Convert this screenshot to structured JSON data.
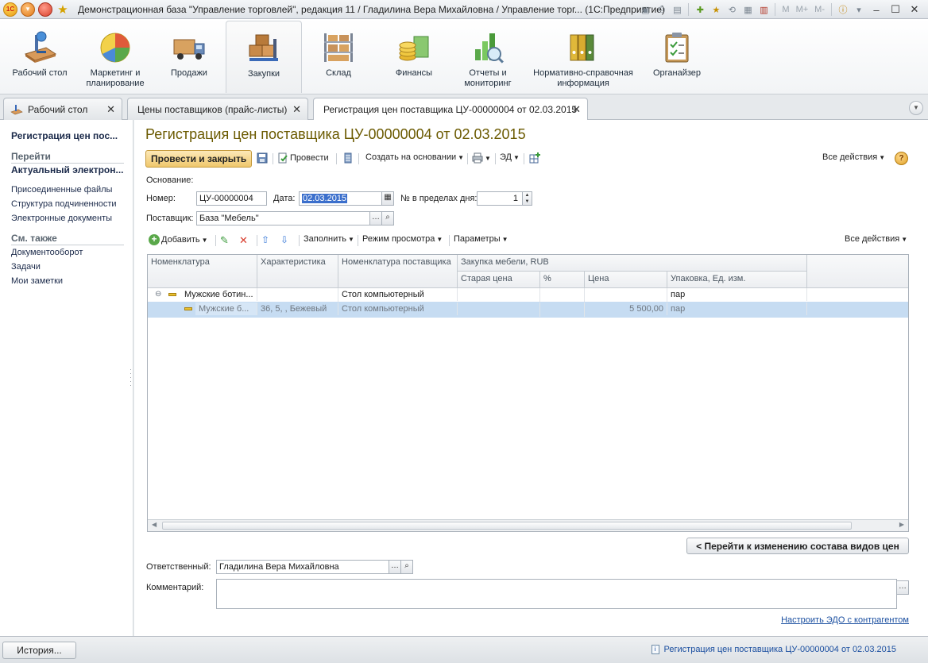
{
  "titlebar": {
    "title": "Демонстрационная база \"Управление торговлей\", редакция 11 / Гладилина Вера Михайловна / Управление торг...  (1С:Предприятие)",
    "mem_labels": [
      "M",
      "M+",
      "M-"
    ]
  },
  "sections": [
    {
      "label": "Рабочий стол",
      "icon": "desktop-icon"
    },
    {
      "label": "Маркетинг и планирование",
      "icon": "marketing-pie-icon"
    },
    {
      "label": "Продажи",
      "icon": "truck-icon"
    },
    {
      "label": "Закупки",
      "icon": "purchases-boxes-icon"
    },
    {
      "label": "Склад",
      "icon": "warehouse-shelf-icon"
    },
    {
      "label": "Финансы",
      "icon": "coins-icon"
    },
    {
      "label": "Отчеты и мониторинг",
      "icon": "report-chart-icon"
    },
    {
      "label": "Нормативно-справочная информация",
      "icon": "binders-icon"
    },
    {
      "label": "Органайзер",
      "icon": "clipboard-icon"
    }
  ],
  "tabs": [
    {
      "label": "Рабочий стол"
    },
    {
      "label": "Цены поставщиков (прайс-листы)"
    },
    {
      "label": "Регистрация цен поставщика ЦУ-00000004 от 02.03.2015"
    }
  ],
  "leftnav": {
    "title": "Регистрация цен пос...",
    "group_goto": "Перейти",
    "current": "Актуальный электрон...",
    "items": [
      "Присоединенные файлы",
      "Структура подчиненности",
      "Электронные документы"
    ],
    "group_see_also": "См. также",
    "see_also": [
      "Документооборот",
      "Задачи",
      "Мои заметки"
    ]
  },
  "form": {
    "title": "Регистрация цен поставщика ЦУ-00000004 от 02.03.2015",
    "post_close": "Провести и закрыть",
    "post": "Провести",
    "create_based": "Создать на основании",
    "edo": "ЭД",
    "all_actions": "Все действия",
    "basis_label": "Основание:",
    "number_label": "Номер:",
    "number": "ЦУ-00000004",
    "date_label": "Дата:",
    "date": "02.03.2015",
    "day_no_label": "№ в пределах дня:",
    "day_no": "1",
    "supplier_label": "Поставщик:",
    "supplier": "База \"Мебель\"",
    "responsible_label": "Ответственный:",
    "responsible": "Гладилина Вера Михайловна",
    "comment_label": "Комментарий:",
    "comment": "",
    "change_price_kinds": "< Перейти к изменению состава видов цен",
    "edo_link": "Настроить ЭДО с контрагентом"
  },
  "table_toolbar": {
    "add": "Добавить",
    "fill": "Заполнить",
    "view_mode": "Режим просмотра",
    "params": "Параметры",
    "all_actions": "Все действия"
  },
  "grid": {
    "headers": {
      "nomenclature": "Номенклатура",
      "characteristic": "Характеристика",
      "supplier_nomenclature": "Номенклатура поставщика",
      "purchase_group": "Закупка мебели, RUB",
      "old_price": "Старая цена",
      "percent": "%",
      "price": "Цена",
      "package": "Упаковка, Ед. изм."
    },
    "rows": [
      {
        "nomenclature": "Мужские ботин...",
        "characteristic": "",
        "supplier_nomenclature": "Стол компьютерный",
        "old_price": "",
        "percent": "",
        "price": "",
        "package": "пар"
      },
      {
        "nomenclature": "Мужские б...",
        "characteristic": "36, 5, , Бежевый",
        "supplier_nomenclature": "Стол компьютерный",
        "old_price": "",
        "percent": "",
        "price": "5 500,00",
        "package": "пар"
      }
    ]
  },
  "statusbar": {
    "history": "История...",
    "message": "Регистрация цен поставщика ЦУ-00000004 от 02.03.2015"
  }
}
